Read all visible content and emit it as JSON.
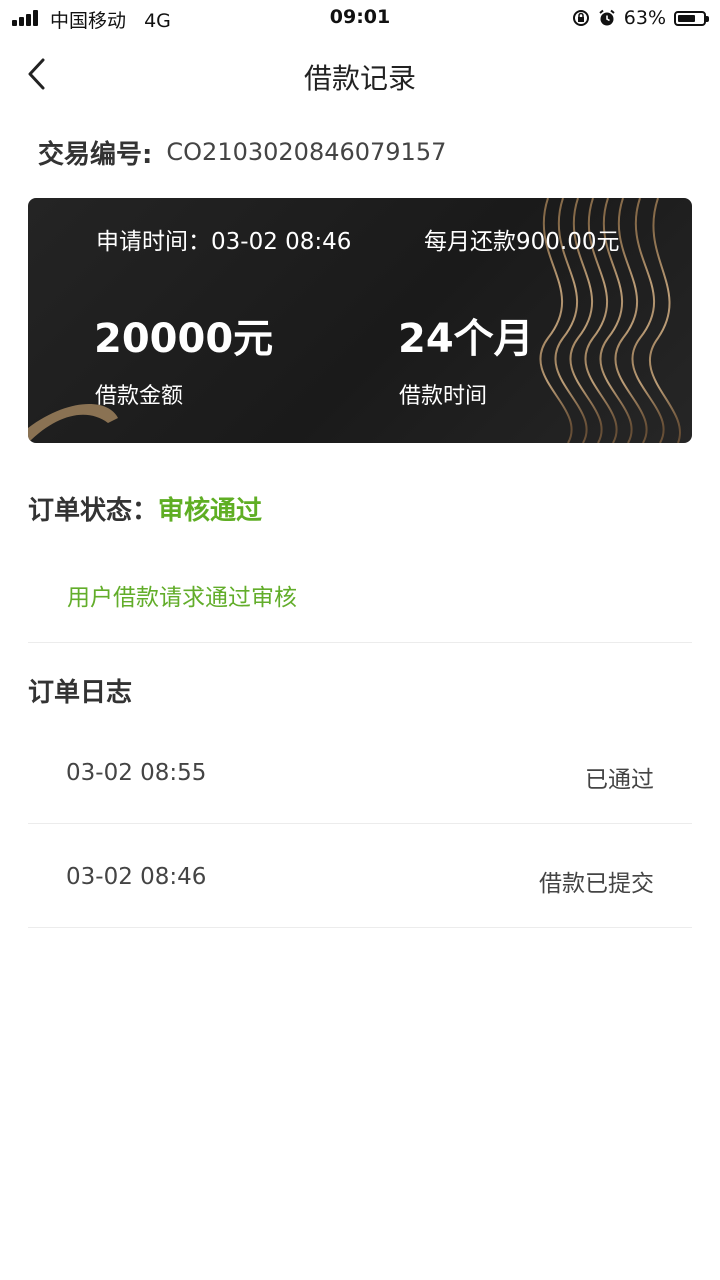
{
  "status_bar": {
    "carrier": "中国移动",
    "network": "4G",
    "time": "09:01",
    "battery": "63%",
    "icons": [
      "signal-icon",
      "orientation-lock-icon",
      "alarm-icon",
      "battery-icon"
    ]
  },
  "nav": {
    "back_icon": "chevron-left-icon",
    "title": "借款记录"
  },
  "transaction": {
    "label": "交易编号:",
    "number": "CO2103020846079157"
  },
  "card": {
    "apply_time": "申请时间：03-02 08:46",
    "monthly_repayment": "每月还款900.00元",
    "amount": "20000元",
    "amount_label": "借款金额",
    "duration": "24个月",
    "duration_label": "借款时间"
  },
  "order_status": {
    "label": "订单状态：",
    "value": "审核通过",
    "description": "用户借款请求通过审核",
    "color": "#5fae24"
  },
  "order_log": {
    "title": "订单日志",
    "entries": [
      {
        "time": "03-02 08:55",
        "status": "已通过"
      },
      {
        "time": "03-02 08:46",
        "status": "借款已提交"
      }
    ]
  }
}
